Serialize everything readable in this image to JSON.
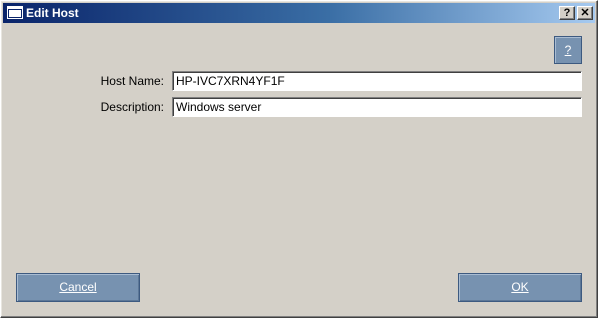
{
  "window": {
    "title": "Edit Host",
    "caption_help": "?",
    "caption_close": "✕"
  },
  "help_button": {
    "label": "?"
  },
  "form": {
    "host_name": {
      "label": "Host Name:",
      "value": "HP-IVC7XRN4YF1F"
    },
    "description": {
      "label": "Description:",
      "value": "Windows server"
    }
  },
  "buttons": {
    "cancel": "Cancel",
    "ok": "OK"
  },
  "colors": {
    "titlebar_start": "#0a246a",
    "titlebar_end": "#a6caf0",
    "dialog_background": "#d4d0c8",
    "button_accent": "#7792b0"
  }
}
